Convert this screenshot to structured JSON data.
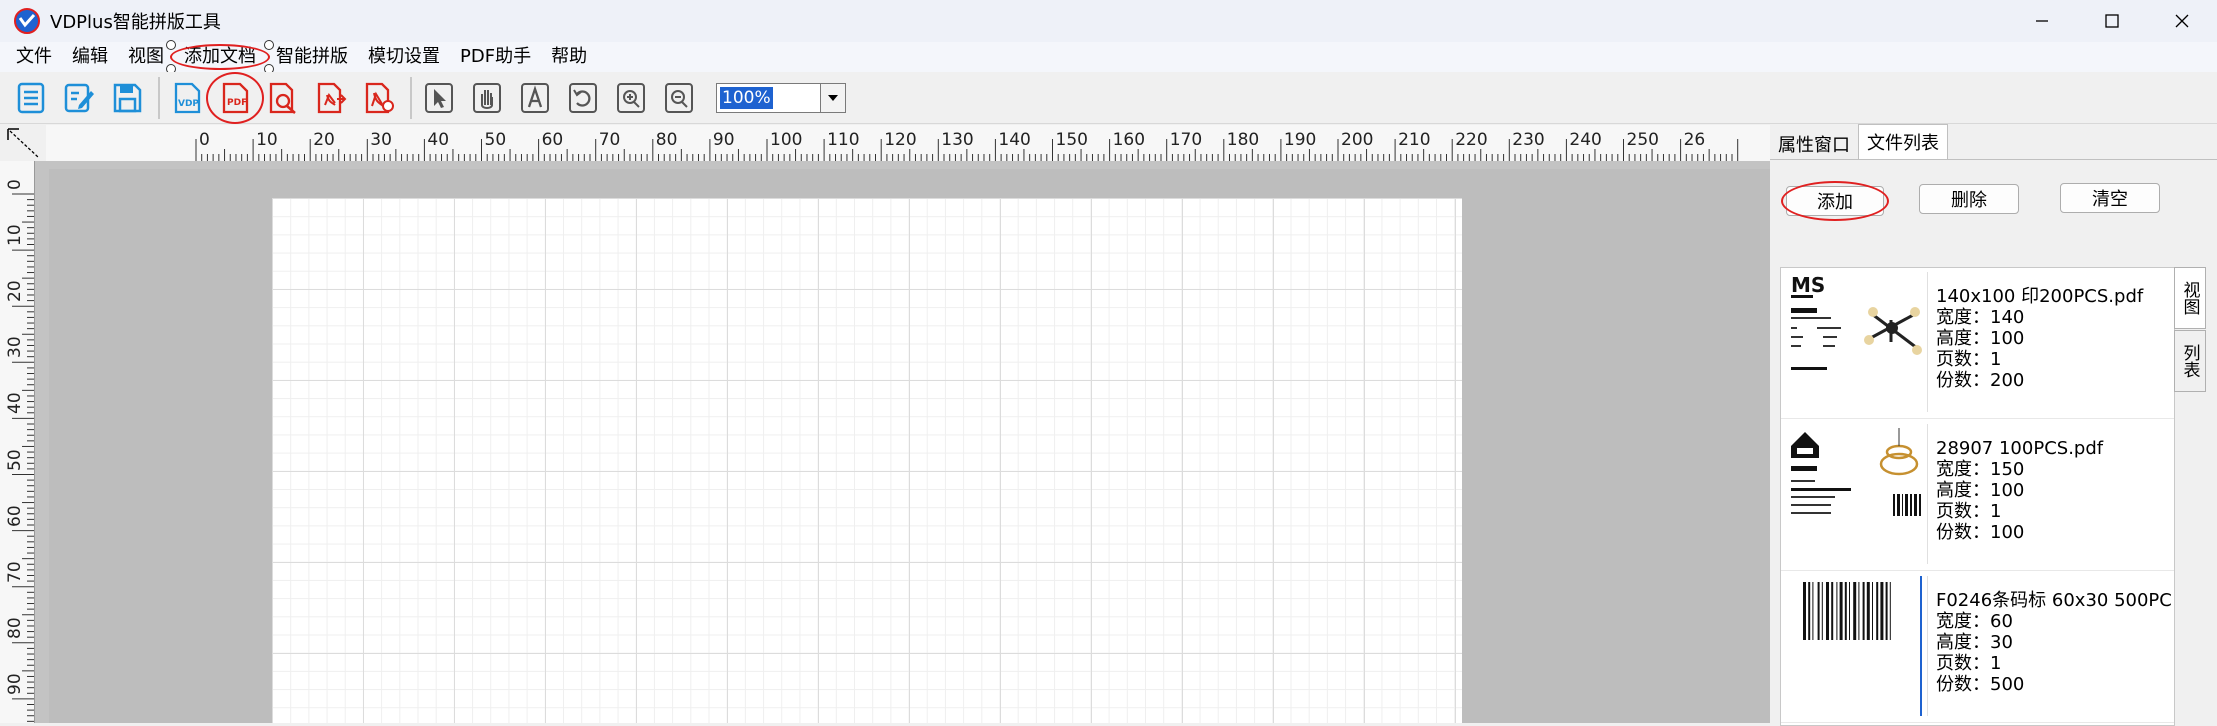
{
  "window": {
    "title": "VDPlus智能拼版工具",
    "controls": {
      "minimize": "minimize-icon",
      "maximize": "maximize-icon",
      "close": "close-icon"
    }
  },
  "menu": {
    "items": [
      "文件",
      "编辑",
      "视图",
      "添加文档",
      "智能拼版",
      "模切设置",
      "PDF助手",
      "帮助"
    ],
    "highlighted_index": 3
  },
  "toolbar": {
    "buttons": [
      "list-icon",
      "edit-icon",
      "save-icon",
      "vdp-icon",
      "add-pdf-icon",
      "pdf-search-icon",
      "pdf-export-icon",
      "pdf-split-icon",
      "select-cursor-icon",
      "pan-hand-icon",
      "text-tool-icon",
      "rotate-icon",
      "zoom-in-icon",
      "zoom-out-icon"
    ],
    "zoom": {
      "value": "100%"
    }
  },
  "ruler": {
    "h_labels": [
      "0",
      "10",
      "20",
      "30",
      "40",
      "50",
      "60",
      "70",
      "80",
      "90",
      "100",
      "110",
      "120",
      "130",
      "140",
      "150",
      "160",
      "170",
      "180",
      "190",
      "200",
      "210",
      "220",
      "230",
      "240",
      "250",
      "26"
    ],
    "v_labels": [
      "0",
      "10",
      "20",
      "30",
      "40",
      "50",
      "60",
      "70",
      "80",
      "90"
    ]
  },
  "panel": {
    "tabs": [
      "属性窗口",
      "文件列表"
    ],
    "active_tab": 1,
    "buttons": {
      "add": "添加",
      "delete": "删除",
      "clear": "清空"
    },
    "side_tabs": [
      "视图",
      "列表"
    ],
    "files": [
      {
        "name": "140x100 印200PCS.pdf",
        "width": "宽度：140",
        "height": "高度：100",
        "pages": "页数：1",
        "copies": "份数：200"
      },
      {
        "name": "28907 100PCS.pdf",
        "width": "宽度：150",
        "height": "高度：100",
        "pages": "页数：1",
        "copies": "份数：100"
      },
      {
        "name": "F0246条码标 60x30 500PC",
        "width": "宽度：60",
        "height": "高度：30",
        "pages": "页数：1",
        "copies": "份数：500"
      }
    ]
  },
  "colors": {
    "accent": "#1e62d0",
    "annotation": "#e02020",
    "pdf_red": "#d9261c",
    "icon_blue": "#1e8fd8"
  }
}
